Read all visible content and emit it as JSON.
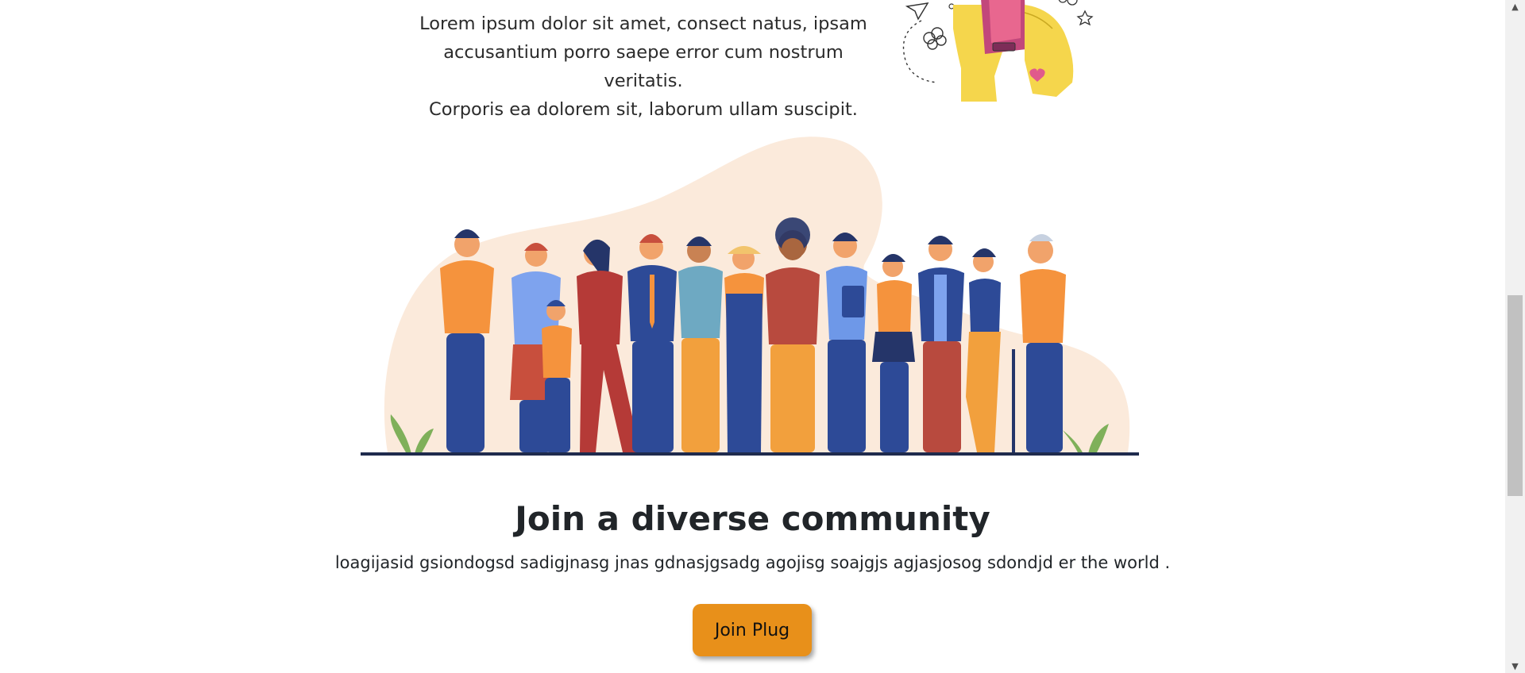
{
  "intro": {
    "lines": [
      "Lorem ipsum dolor sit amet, consect natus, ipsam",
      "accusantium porro saepe error cum nostrum veritatis.",
      "Corporis ea dolorem sit, laborum ullam suscipit."
    ]
  },
  "community": {
    "title": "Join a diverse community",
    "description": "loagijasid gsiondogsd sadigjnasg jnas gdnasjgsadg agojisg soajgjs agjasjosog sdondjd er the world .",
    "button_label": "Join Plug"
  },
  "scrollbar": {
    "up_icon": "arrow-up-icon",
    "down_icon": "arrow-down-icon"
  },
  "colors": {
    "button": "#e8901a",
    "blob": "#fbeadb",
    "ground": "#1f2b4d"
  }
}
